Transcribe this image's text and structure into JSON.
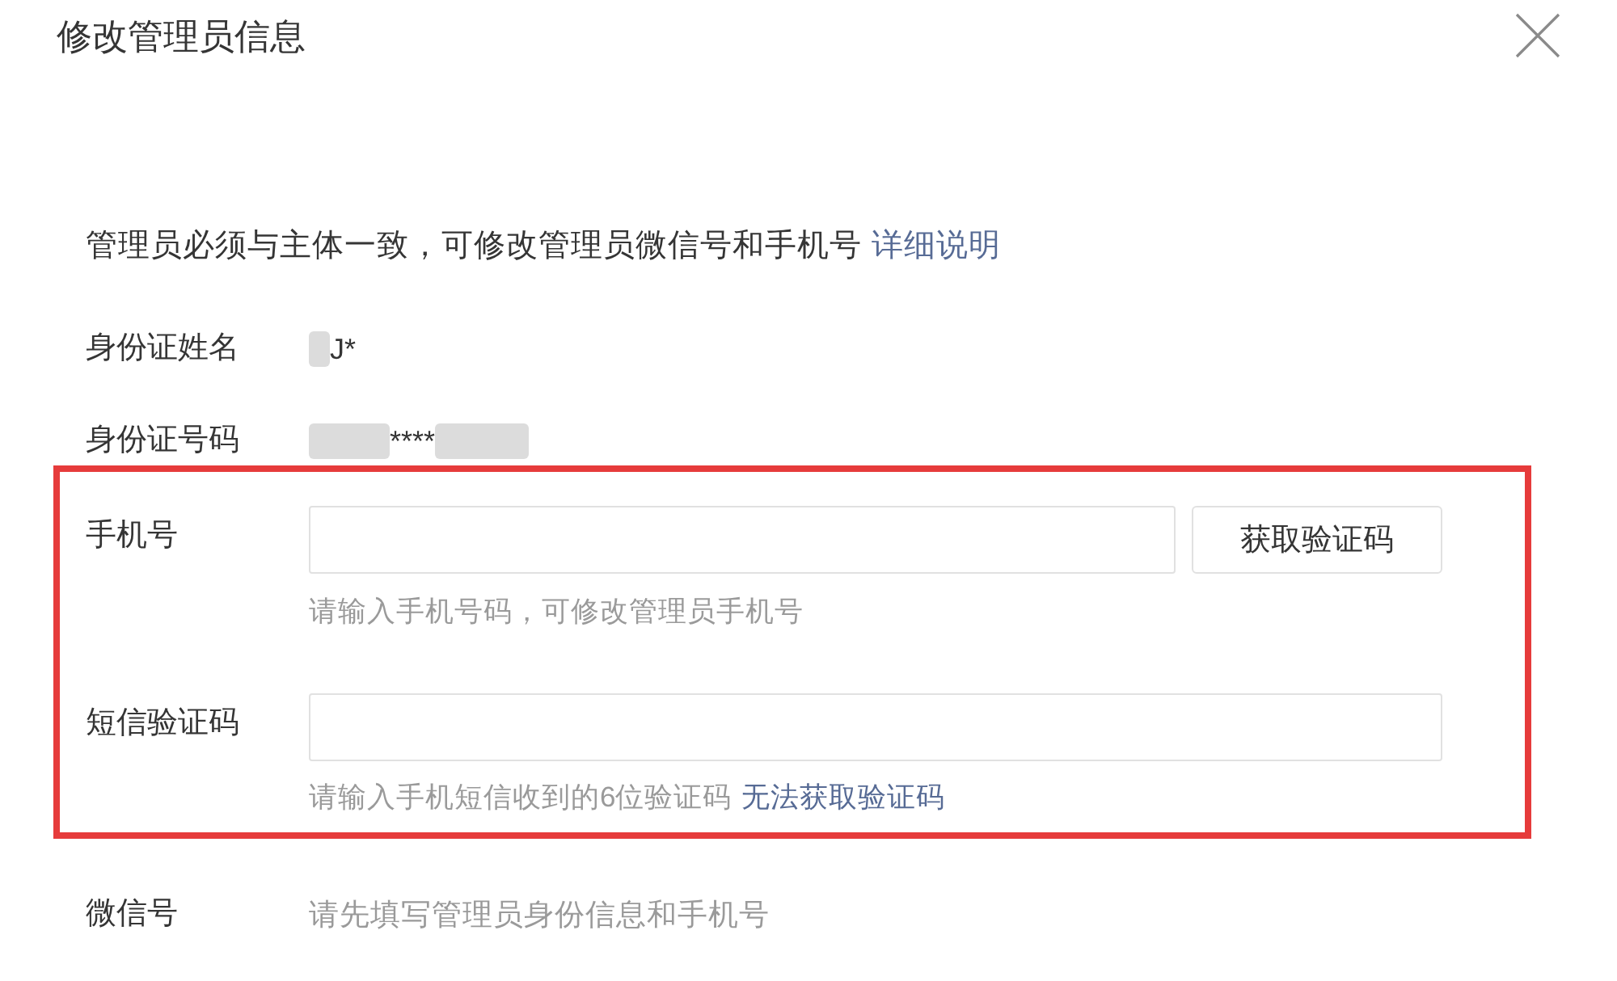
{
  "dialog": {
    "title": "修改管理员信息"
  },
  "notice": {
    "text": "管理员必须与主体一致，可修改管理员微信号和手机号",
    "link": "详细说明"
  },
  "identity": [
    {
      "label": "身份证姓名",
      "value": "J*",
      "blurred_before": true,
      "blurred_after": false
    },
    {
      "label": "身份证号码",
      "value": "****",
      "blurred_before": true,
      "blurred_after": true
    }
  ],
  "verification": {
    "highlighted": true,
    "phone": {
      "label": "手机号",
      "button": "获取验证码",
      "hint": "请输入手机号码，可修改管理员手机号"
    },
    "sms_code": {
      "label": "短信验证码",
      "hint": "请输入手机短信收到的6位验证码",
      "hint_link": "无法获取验证码"
    }
  },
  "wechat": {
    "label": "微信号",
    "value": "请先填写管理员身份信息和手机号"
  }
}
